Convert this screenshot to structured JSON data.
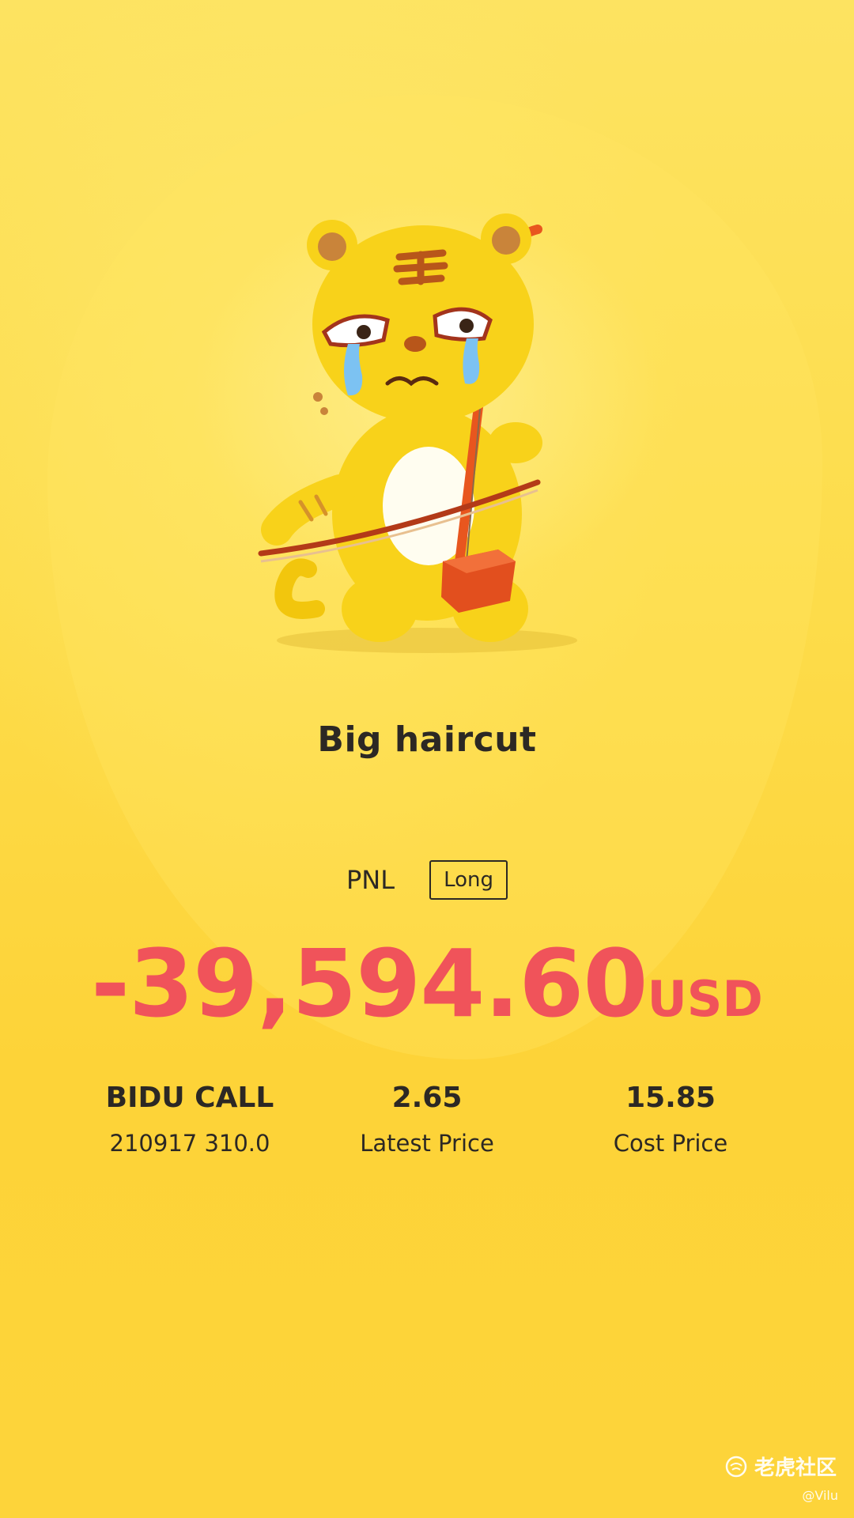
{
  "title": "Big haircut",
  "pnl": {
    "label": "PNL",
    "position_tag": "Long",
    "amount": "-39,594.60",
    "currency": "USD",
    "amount_color": "#f0535a"
  },
  "stats": [
    {
      "main": "BIDU CALL",
      "sub": "210917 310.0"
    },
    {
      "main": "2.65",
      "sub": "Latest Price"
    },
    {
      "main": "15.85",
      "sub": "Cost Price"
    }
  ],
  "watermark": {
    "brand": "老虎社区",
    "user": "@Vilu"
  },
  "mascot": {
    "icon": "crying-tiger-playing-erhu-icon"
  }
}
